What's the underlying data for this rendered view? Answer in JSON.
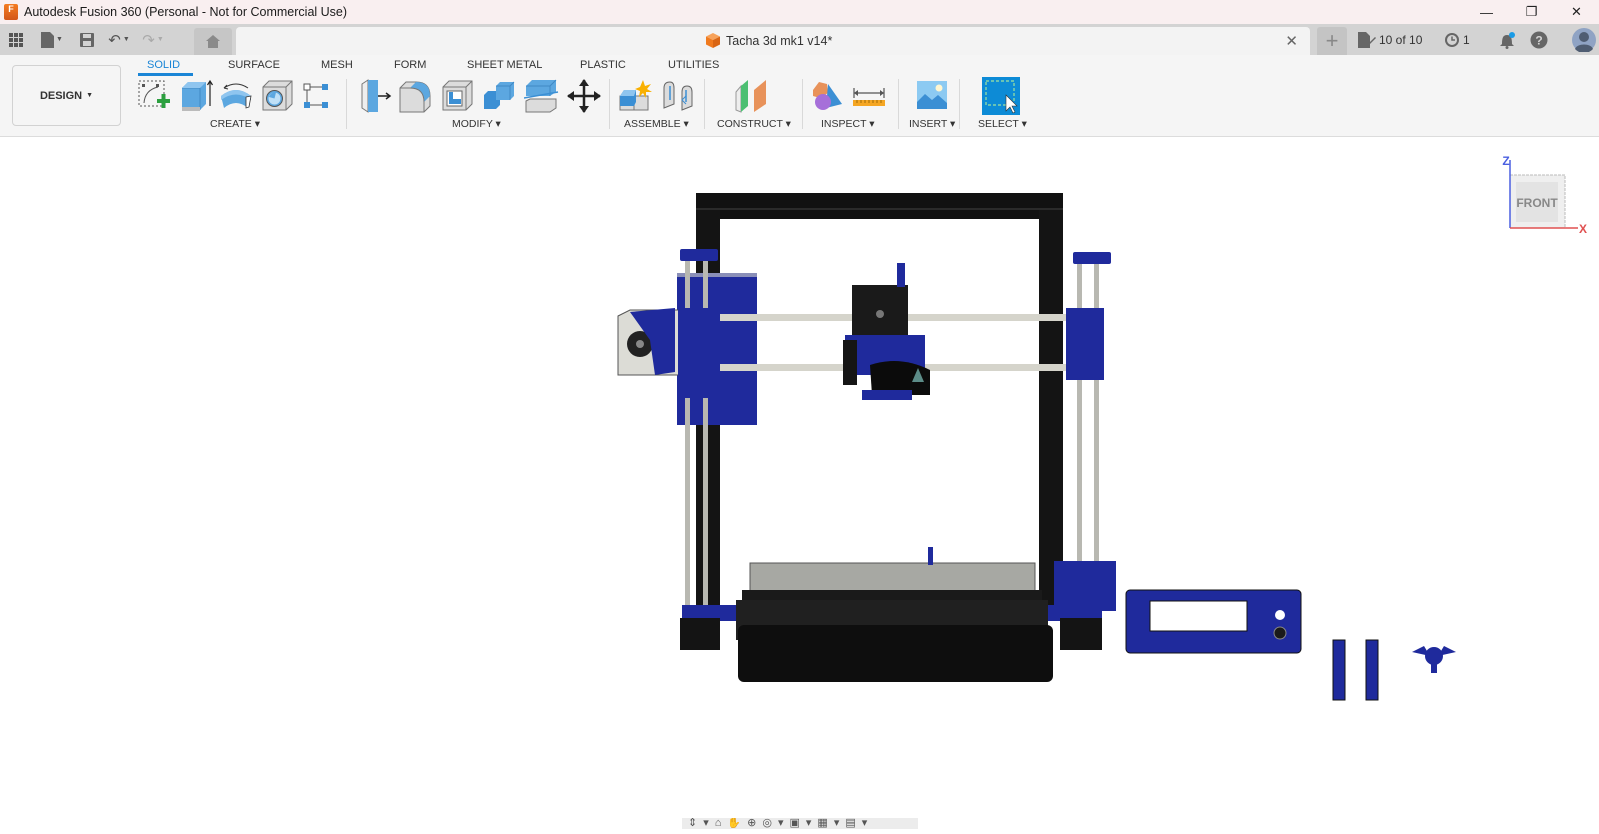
{
  "window": {
    "title": "Autodesk Fusion 360 (Personal - Not for Commercial Use)",
    "logo_text": "F",
    "controls": {
      "minimize": "—",
      "maximize": "❐",
      "close": "✕"
    }
  },
  "quick_access": {
    "grid_icon": "▦",
    "file_icon": "▬",
    "save_icon": "💾",
    "undo_icon": "↶",
    "redo_icon": "↷",
    "caret": "▼",
    "home_icon": "⌂"
  },
  "document_tab": {
    "title": "Tacha 3d mk1 v14*",
    "close": "✕"
  },
  "new_tab": "+",
  "status": {
    "versions": "10 of 10",
    "jobs_count": "1",
    "notification_color": "#1a9be6"
  },
  "ribbon": {
    "workspace": "DESIGN",
    "workspace_caret": "▼",
    "tabs": [
      {
        "label": "SOLID",
        "active": true
      },
      {
        "label": "SURFACE",
        "active": false
      },
      {
        "label": "MESH",
        "active": false
      },
      {
        "label": "FORM",
        "active": false
      },
      {
        "label": "SHEET METAL",
        "active": false
      },
      {
        "label": "PLASTIC",
        "active": false
      },
      {
        "label": "UTILITIES",
        "active": false
      }
    ],
    "groups": [
      {
        "label": "CREATE ▾",
        "tools": [
          "Create Sketch",
          "Extrude",
          "Revolve",
          "Hole",
          "Pattern"
        ]
      },
      {
        "label": "MODIFY ▾",
        "tools": [
          "Press Pull",
          "Fillet",
          "Shell",
          "Combine",
          "Split Body",
          "Move/Copy"
        ]
      },
      {
        "label": "ASSEMBLE ▾",
        "tools": [
          "New Component",
          "Joint"
        ]
      },
      {
        "label": "CONSTRUCT ▾",
        "tools": [
          "Offset Plane"
        ]
      },
      {
        "label": "INSPECT ▾",
        "tools": [
          "Section Analysis",
          "Measure"
        ]
      },
      {
        "label": "INSERT ▾",
        "tools": [
          "Insert Image"
        ]
      },
      {
        "label": "SELECT ▾",
        "tools": [
          "Select"
        ]
      }
    ],
    "accent": "#1a85d6"
  },
  "viewcube": {
    "face": "FRONT",
    "axis_z": "Z",
    "axis_x": "X"
  },
  "model": {
    "name": "3D printer assembly",
    "frame_color": "#111111",
    "part_color": "#1f2a9c",
    "rod_color": "#bdbdb5",
    "bed_color": "#a7a8a3"
  },
  "nav_bar": {
    "icons": [
      "⇕",
      "▾",
      "⌂",
      "✋",
      "⊕",
      "◎",
      "▾",
      "▣",
      "▾",
      "▦",
      "▾",
      "▤",
      "▾"
    ]
  }
}
